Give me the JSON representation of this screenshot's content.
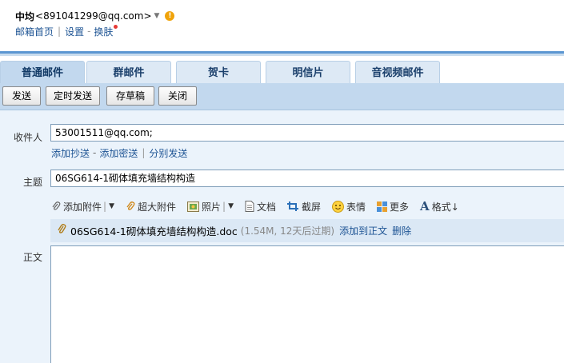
{
  "header": {
    "name": "中均",
    "email": "<891041299@qq.com>",
    "nav": [
      "邮箱首页",
      "设置",
      "换肤"
    ]
  },
  "tabs": [
    {
      "label": "普通邮件",
      "active": true
    },
    {
      "label": "群邮件",
      "active": false
    },
    {
      "label": "贺卡",
      "active": false
    },
    {
      "label": "明信片",
      "active": false
    },
    {
      "label": "音视频邮件",
      "active": false
    }
  ],
  "toolbar": {
    "send": "发送",
    "scheduled_send": "定时发送",
    "save_draft": "存草稿",
    "close": "关闭"
  },
  "compose": {
    "recipient_label": "收件人",
    "recipient_value": "53001511@qq.com;",
    "add_cc": "添加抄送",
    "add_bcc": "添加密送",
    "separate_send": "分别发送",
    "subject_label": "主题",
    "subject_value": "06SG614-1砌体填充墙结构构造",
    "body_label": "正文"
  },
  "tools": {
    "add_attachment": "添加附件",
    "big_attachment": "超大附件",
    "photo": "照片",
    "document": "文档",
    "screenshot": "截屏",
    "emoji": "表情",
    "more": "更多",
    "format": "格式↓"
  },
  "attachment": {
    "filename": "06SG614-1砌体填充墙结构构造.doc",
    "meta": "(1.54M, 12天后过期)",
    "add_to_body": "添加到正文",
    "delete": "删除"
  },
  "colors": {
    "link": "#1e5494",
    "toolbar_bg": "#c2d8ee",
    "compose_bg": "#ebf3fb",
    "accent_stripe": "#5b96d1"
  }
}
